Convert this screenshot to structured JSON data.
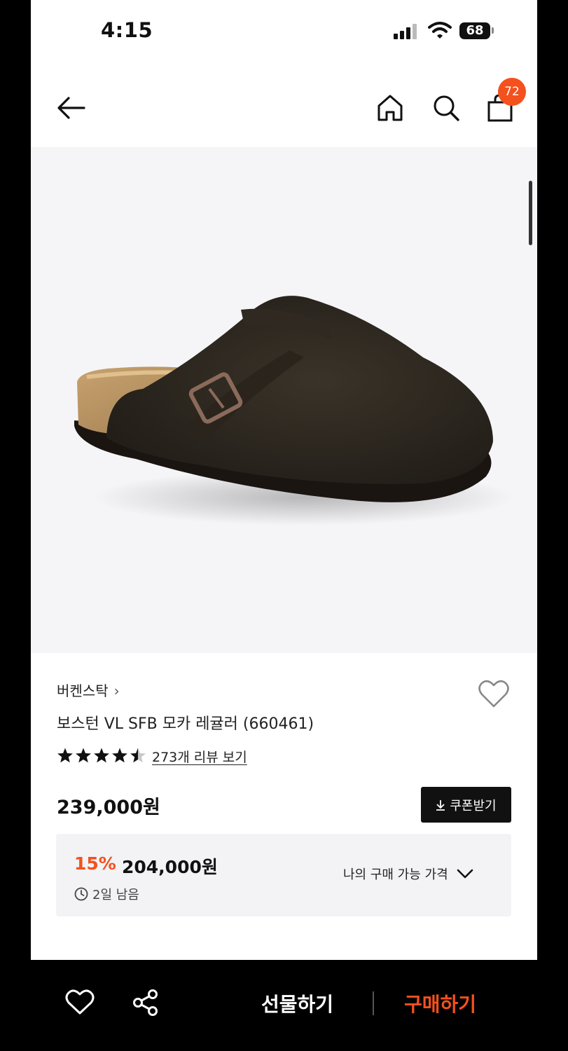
{
  "status_bar": {
    "time": "4:15",
    "battery": "68"
  },
  "header": {
    "cart_count": "72"
  },
  "product": {
    "brand": "버켄스탁",
    "brand_chevron": "›",
    "title": "보스턴 VL SFB 모카 레귤러 (660461)",
    "rating": 4.5,
    "review_link": "273개 리뷰 보기",
    "price": "239,000원",
    "coupon_button": "쿠폰받기"
  },
  "deal": {
    "discount": "15%",
    "price": "204,000원",
    "time_left": "2일 남음",
    "toggle_label": "나의 구매 가능 가격"
  },
  "bottom_bar": {
    "gift_label": "선물하기",
    "buy_label": "구매하기"
  },
  "colors": {
    "accent": "#f4511e",
    "dark": "#111111",
    "deal_bg": "#f3f3f5"
  }
}
